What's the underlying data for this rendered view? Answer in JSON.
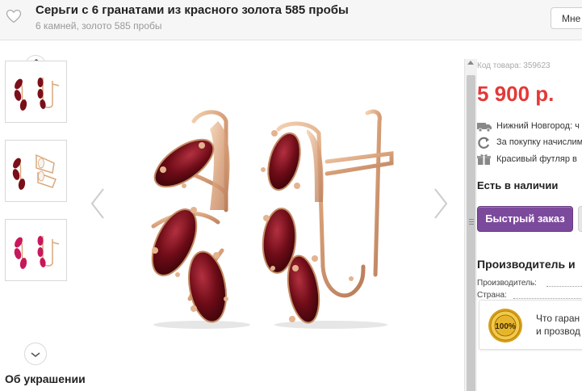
{
  "header": {
    "title": "Серьги с 6 гранатами из красного золота 585 пробы",
    "subtitle": "6 камней, золото 585 пробы",
    "more_label": "Мне"
  },
  "gallery": {
    "thumbnails": [
      {
        "variant": "garnet"
      },
      {
        "variant": "garnet-white"
      },
      {
        "variant": "ruby"
      }
    ]
  },
  "about_heading": "Об украшении",
  "product": {
    "code": "Код товара: 359623",
    "price": "5 900 р.",
    "features": [
      {
        "icon": "truck-icon",
        "text": "Нижний Новгород: ч"
      },
      {
        "icon": "refresh-icon",
        "text": "За покупку начислим"
      },
      {
        "icon": "gift-icon",
        "text": "Красивый футляр в"
      }
    ],
    "stock": "Есть в наличии",
    "quick_order_label": "Быстрый заказ",
    "manufacturer_heading": "Производитель и",
    "specs": [
      {
        "label": "Производитель:"
      },
      {
        "label": "Страна:"
      }
    ],
    "guarantee": {
      "seal_text": "100%",
      "line1": "Что гаран",
      "line2": "и прозвод"
    }
  },
  "colors": {
    "price": "#e53838",
    "button": "#7c4a9c",
    "gem": "#7a0f1a",
    "gold": "#d9a87c"
  }
}
